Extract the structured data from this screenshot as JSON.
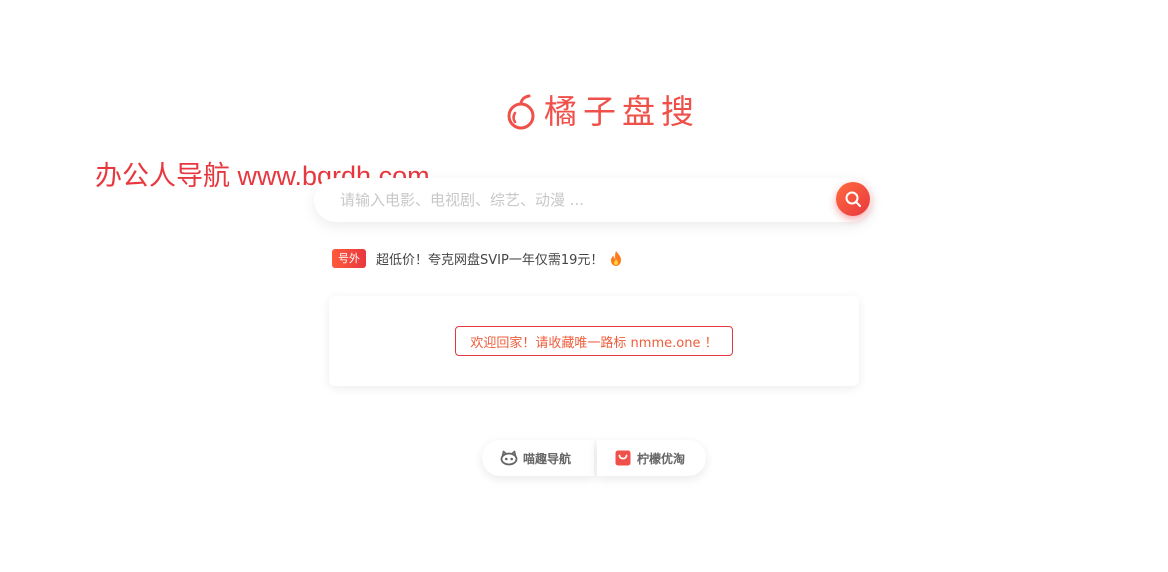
{
  "logo": {
    "name": "橘子盘搜",
    "icon": "orange-icon"
  },
  "watermark": "办公人导航 www.bgrdh.com",
  "search": {
    "placeholder": "请输入电影、电视剧、综艺、动漫 ...",
    "value": "",
    "button_icon": "search-icon"
  },
  "promo": {
    "badge": "号外",
    "text": "超低价！夸克网盘SVIP一年仅需19元！",
    "icon": "fire-icon"
  },
  "notice": {
    "text": "欢迎回家！请收藏唯一路标 nmme.one ！"
  },
  "links": [
    {
      "label": "喵趣导航",
      "icon": "cat-icon"
    },
    {
      "label": "柠檬优淘",
      "icon": "shopping-bag-icon"
    }
  ],
  "colors": {
    "accent": "#e8383f",
    "accent_orange": "#ff6a3d",
    "text": "#444444",
    "placeholder": "#c8c8c8"
  }
}
